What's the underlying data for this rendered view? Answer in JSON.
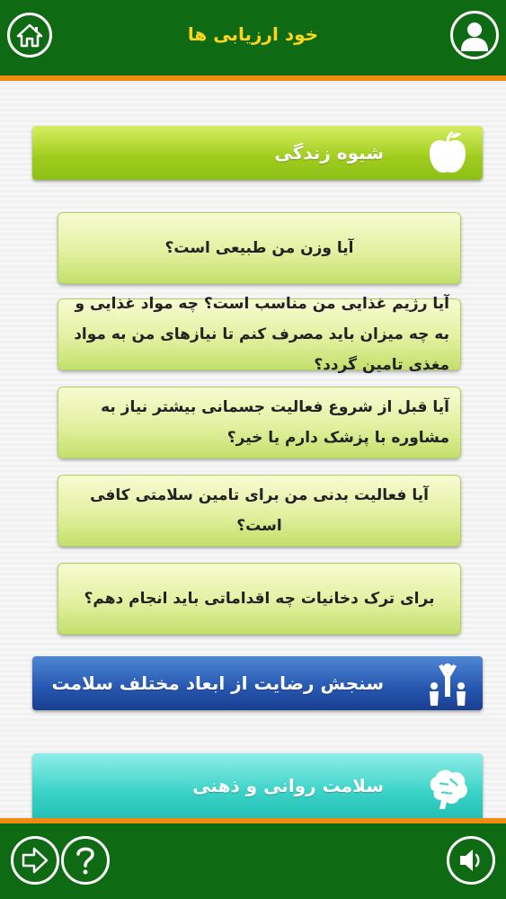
{
  "header": {
    "title": "خود ارزیابی ها",
    "home_icon": "home-icon",
    "profile_icon": "user-profile-icon"
  },
  "categories": [
    {
      "label": "شیوه زندگی",
      "icon": "apple-icon",
      "color": "#9fcc1c"
    },
    {
      "label": "سنجش رضایت از ابعاد مختلف سلامت",
      "icon": "family-people-icon",
      "color": "#2656b0"
    },
    {
      "label": "سلامت روانی و ذهنی",
      "icon": "brain-icon",
      "color": "#3bd3c8"
    }
  ],
  "questions": [
    {
      "text": "آیا وزن من طبیعی است؟"
    },
    {
      "text": "آیا رژیم غذایی من مناسب است؟ چه مواد غذایی و به چه میزان باید مصرف کنم تا نیازهای من به مواد مغذی تامین گردد؟"
    },
    {
      "text": "آیا قبل از شروع فعالیت جسمانی بیشتر نیاز به مشاوره با پزشک دارم یا خیر؟"
    },
    {
      "text": "آیا فعالیت بدنی من برای تامین سلامتی کافی است؟"
    },
    {
      "text": "برای ترک دخانیات چه اقداماتی باید انجام دهم؟"
    }
  ],
  "footer": {
    "next_icon": "arrow-right-icon",
    "help_icon": "question-mark-icon",
    "sound_icon": "speaker-icon"
  },
  "colors": {
    "bar": "#0f6b13",
    "accent": "#f28a12",
    "title": "#ffd51c"
  }
}
